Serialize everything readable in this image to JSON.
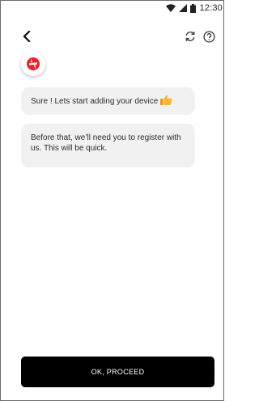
{
  "status_bar": {
    "time": "12:30",
    "icons": [
      "wifi-icon",
      "cell-signal-icon",
      "battery-icon"
    ]
  },
  "header": {
    "back_icon": "chevron-left-icon",
    "refresh_icon": "refresh-icon",
    "help_icon": "help-icon"
  },
  "chat": {
    "avatar_icon": "brand-logo-icon",
    "messages": [
      {
        "text": "Sure ! Lets start adding your device",
        "emoji": "thumbs-up-icon"
      },
      {
        "text": "Before that, we’ll need you to register with us. This will be quick."
      }
    ]
  },
  "footer": {
    "proceed_label": "OK, PROCEED"
  },
  "colors": {
    "brand_red": "#e8212e",
    "bubble_bg": "#f1f1f1",
    "button_bg": "#000000",
    "thumb_yellow": "#f7b733"
  }
}
